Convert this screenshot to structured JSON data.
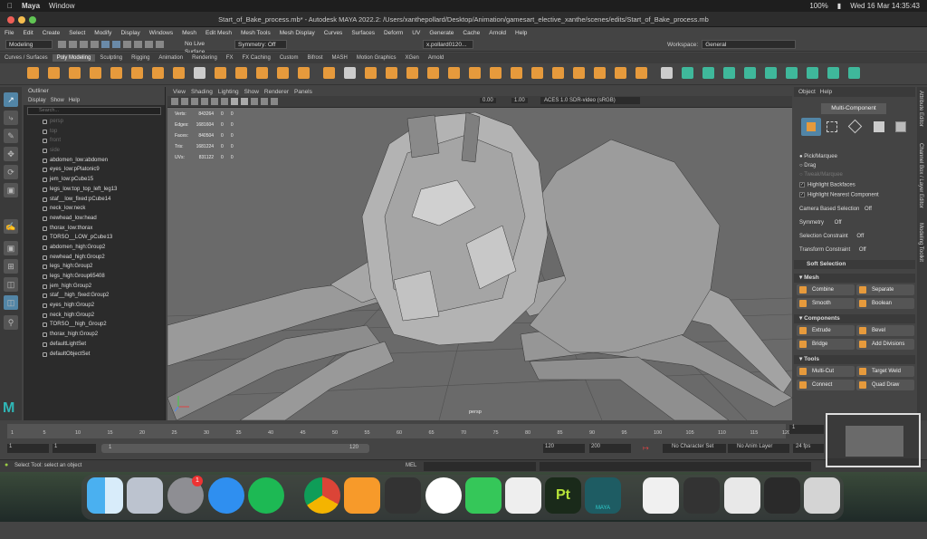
{
  "mac_menubar": {
    "app": "Maya",
    "menu": "Window",
    "battery": "100%",
    "datetime": "Wed 16 Mar  14:35:43"
  },
  "window_title": "Start_of_Bake_process.mb* - Autodesk MAYA 2022.2: /Users/xanthepollard/Desktop/Animation/gamesart_elective_xanthe/scenes/edits/Start_of_Bake_process.mb",
  "menus": [
    "File",
    "Edit",
    "Create",
    "Select",
    "Modify",
    "Display",
    "Windows",
    "Mesh",
    "Edit Mesh",
    "Mesh Tools",
    "Mesh Display",
    "Curves",
    "Surfaces",
    "Deform",
    "UV",
    "Generate",
    "Cache",
    "Arnold",
    "Help"
  ],
  "status_line": {
    "mode": "Modeling",
    "live_surface": "No Live Surface",
    "symmetry": "Symmetry: Off",
    "user": "x.pollard0120...",
    "workspace_label": "Workspace:",
    "workspace": "General"
  },
  "shelf_tabs": [
    "Curves / Surfaces",
    "Poly Modeling",
    "Sculpting",
    "Rigging",
    "Animation",
    "Rendering",
    "FX",
    "FX Caching",
    "Custom",
    "Bifrost",
    "MASH",
    "Motion Graphics",
    "XGen",
    "Arnold"
  ],
  "shelf_active": "Poly Modeling",
  "outliner": {
    "title": "Outliner",
    "menus": [
      "Display",
      "Show",
      "Help"
    ],
    "search_placeholder": "Search...",
    "items": [
      {
        "label": "persp",
        "dim": true
      },
      {
        "label": "top",
        "dim": true
      },
      {
        "label": "front",
        "dim": true
      },
      {
        "label": "side",
        "dim": true
      },
      {
        "label": "abdomen_low:abdomen",
        "dim": false
      },
      {
        "label": "eyes_low:pPlatonic9",
        "dim": false
      },
      {
        "label": "jem_low:pCube15",
        "dim": false
      },
      {
        "label": "legs_low:top_top_left_leg13",
        "dim": false
      },
      {
        "label": "staf__low_fixed:pCube14",
        "dim": false
      },
      {
        "label": "neck_low:neck",
        "dim": false
      },
      {
        "label": "newhead_low:head",
        "dim": false
      },
      {
        "label": "thorax_low:thorax",
        "dim": false
      },
      {
        "label": "TORSO__LOW_pCube13",
        "dim": false
      },
      {
        "label": "abdomen_high:Group2",
        "dim": false
      },
      {
        "label": "newhead_high:Group2",
        "dim": false
      },
      {
        "label": "legs_high:Group2",
        "dim": false
      },
      {
        "label": "legs_high:Group65408",
        "dim": false
      },
      {
        "label": "jem_high:Group2",
        "dim": false
      },
      {
        "label": "staf__high_fixed:Group2",
        "dim": false
      },
      {
        "label": "eyes_high:Group2",
        "dim": false
      },
      {
        "label": "neck_high:Group2",
        "dim": false
      },
      {
        "label": "TORSO__high_Group2",
        "dim": false
      },
      {
        "label": "thorax_high:Group2",
        "dim": false
      },
      {
        "label": "defaultLightSet",
        "dim": false
      },
      {
        "label": "defaultObjectSet",
        "dim": false
      }
    ]
  },
  "viewport": {
    "menus": [
      "View",
      "Shading",
      "Lighting",
      "Show",
      "Renderer",
      "Panels"
    ],
    "exposure": "0.00",
    "gamma": "1.00",
    "colorspace": "ACES 1.0 SDR-video (sRGB)",
    "camera": "persp",
    "hud": [
      {
        "label": "Verts:",
        "a": "843264",
        "b": "0",
        "c": "0"
      },
      {
        "label": "Edges:",
        "a": "1681604",
        "b": "0",
        "c": "0"
      },
      {
        "label": "Faces:",
        "a": "840504",
        "b": "0",
        "c": "0"
      },
      {
        "label": "Tris:",
        "a": "1681224",
        "b": "0",
        "c": "0"
      },
      {
        "label": "UVs:",
        "a": "831122",
        "b": "0",
        "c": "0"
      }
    ]
  },
  "modeling_toolkit": {
    "tabs": [
      "Object",
      "Help"
    ],
    "mode_button": "Multi-Component",
    "pick_marquee": "Pick/Marquee",
    "drag": "Drag",
    "tweak_marquee": "Tweak/Marquee",
    "highlight_backfaces": "Highlight Backfaces",
    "highlight_nearest": "Highlight Nearest Component",
    "camera_based_label": "Camera Based Selection",
    "camera_based_value": "Off",
    "symmetry_label": "Symmetry",
    "symmetry_value": "Off",
    "sel_constraint_label": "Selection Constraint",
    "sel_constraint_value": "Off",
    "xform_constraint_label": "Transform Constraint",
    "xform_constraint_value": "Off",
    "soft_selection": "Soft Selection",
    "mesh_header": "Mesh",
    "combine": "Combine",
    "separate": "Separate",
    "smooth": "Smooth",
    "boolean": "Boolean",
    "components_header": "Components",
    "extrude": "Extrude",
    "bevel": "Bevel",
    "bridge": "Bridge",
    "add_divisions": "Add Divisions",
    "tools_header": "Tools",
    "multi_cut": "Multi-Cut",
    "target_weld": "Target Weld",
    "connect": "Connect",
    "quad_draw": "Quad Draw"
  },
  "side_tabs": [
    "Attribute Editor",
    "Channel Box / Layer Editor",
    "Modeling Toolkit"
  ],
  "timeline": {
    "ticks": [
      "1",
      "5",
      "10",
      "15",
      "20",
      "25",
      "30",
      "35",
      "40",
      "45",
      "50",
      "55",
      "60",
      "65",
      "70",
      "75",
      "80",
      "85",
      "90",
      "95",
      "100",
      "105",
      "110",
      "115",
      "120"
    ],
    "current_frame": "1"
  },
  "range": {
    "start": "1",
    "anim_start": "1",
    "slider_start": "1",
    "slider_end": "120",
    "end": "120",
    "anim_end": "200",
    "character_set": "No Character Set",
    "anim_layer": "No Anim Layer",
    "fps": "24 fps"
  },
  "command_line": {
    "lang": "MEL",
    "help": "Select Tool: select an object"
  },
  "dock": {
    "badge": "1",
    "maya_label": "MAYA",
    "pt_label": "Pt"
  }
}
